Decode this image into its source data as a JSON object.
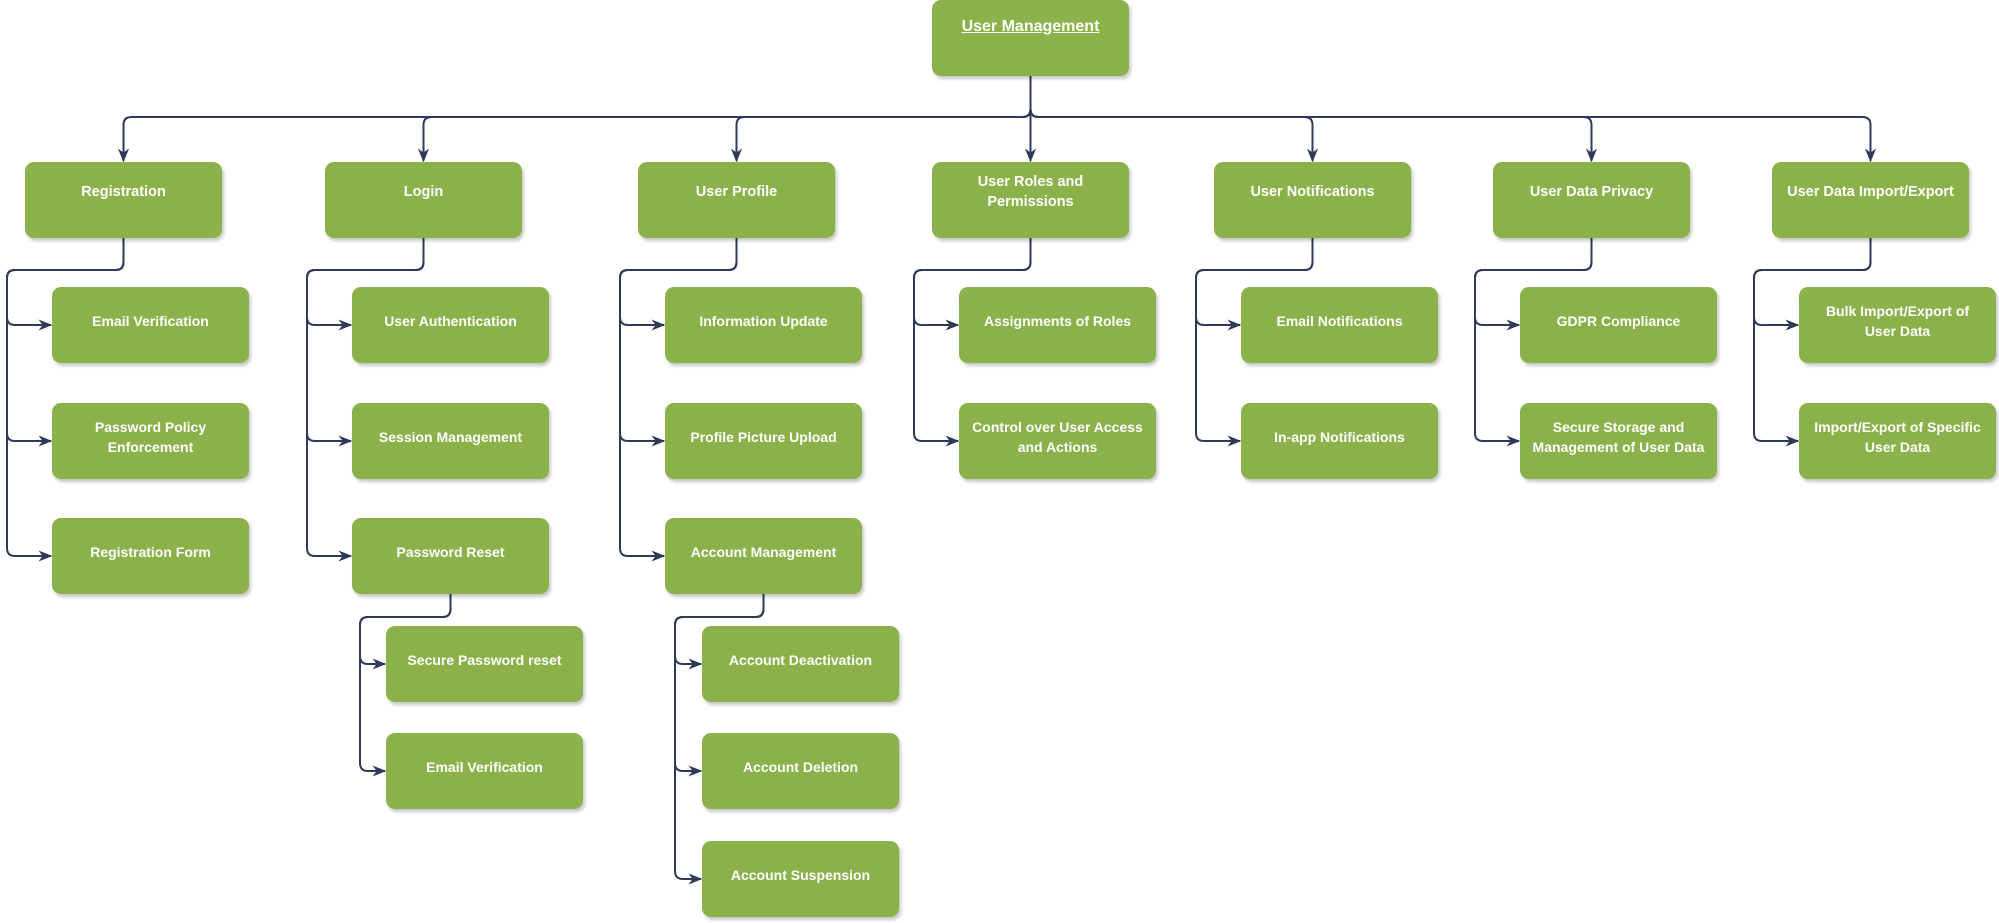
{
  "diagram": {
    "type": "hierarchy",
    "colors": {
      "node_fill": "#8bb14a",
      "node_text": "#ffffff",
      "connector": "#2f3a5a"
    },
    "root": {
      "label": "User Management"
    },
    "branches": [
      {
        "label": "Registration",
        "children": [
          {
            "label": "Email Verification"
          },
          {
            "label": "Password Policy Enforcement"
          },
          {
            "label": "Registration Form"
          }
        ]
      },
      {
        "label": "Login",
        "children": [
          {
            "label": "User Authentication"
          },
          {
            "label": "Session Management"
          },
          {
            "label": "Password Reset",
            "children": [
              {
                "label": "Secure Password reset"
              },
              {
                "label": "Email Verification"
              }
            ]
          }
        ]
      },
      {
        "label": "User Profile",
        "children": [
          {
            "label": "Information Update"
          },
          {
            "label": "Profile Picture Upload"
          },
          {
            "label": "Account Management",
            "children": [
              {
                "label": "Account Deactivation"
              },
              {
                "label": "Account Deletion"
              },
              {
                "label": "Account Suspension"
              }
            ]
          }
        ]
      },
      {
        "label": "User Roles and Permissions",
        "children": [
          {
            "label": "Assignments of Roles"
          },
          {
            "label": "Control over User Access and Actions"
          }
        ]
      },
      {
        "label": "User Notifications",
        "children": [
          {
            "label": "Email Notifications"
          },
          {
            "label": "In-app Notifications"
          }
        ]
      },
      {
        "label": "User Data Privacy",
        "children": [
          {
            "label": "GDPR Compliance"
          },
          {
            "label": "Secure Storage and Management of User Data"
          }
        ]
      },
      {
        "label": "User Data Import/Export",
        "children": [
          {
            "label": "Bulk Import/Export of User Data"
          },
          {
            "label": "Import/Export of Specific User Data"
          }
        ]
      }
    ]
  }
}
